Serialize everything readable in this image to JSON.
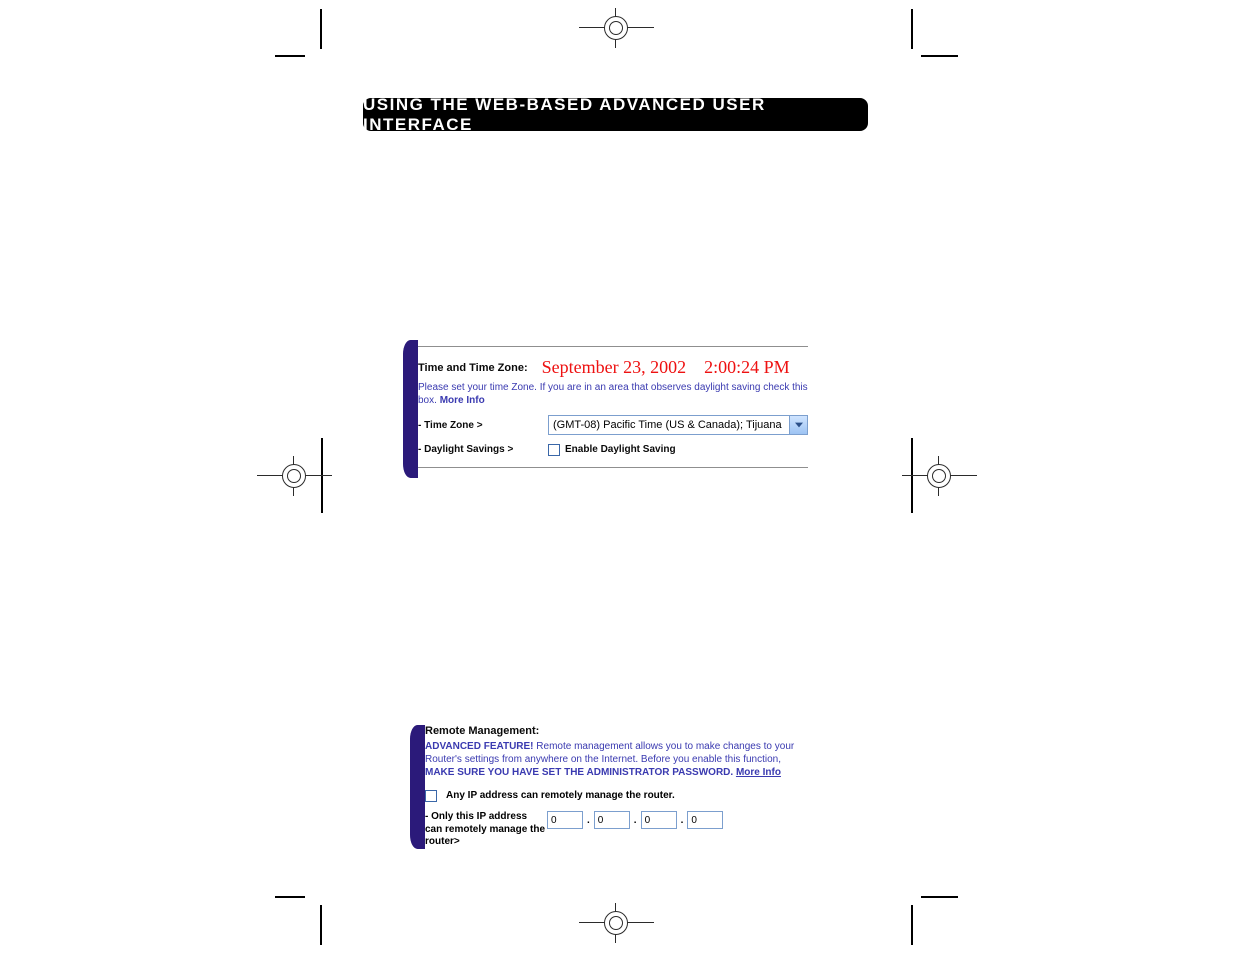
{
  "title": "USING THE WEB-BASED ADVANCED USER INTERFACE",
  "time_panel": {
    "heading": "Time and Time Zone:",
    "date": "September 23, 2002",
    "time": "2:00:24 PM",
    "help": "Please set your time Zone. If you are in an area that observes daylight saving check this box.",
    "more_info": "More Info",
    "tz_label": "- Time Zone >",
    "tz_value": "(GMT-08) Pacific Time (US & Canada); Tijuana",
    "ds_label": "- Daylight Savings >",
    "ds_checkbox_label": "Enable Daylight Saving"
  },
  "remote_panel": {
    "heading": "Remote Management:",
    "adv_label": "ADVANCED FEATURE!",
    "body": "Remote management allows you to make changes to your Router's settings from anywhere on the Internet. Before you enable this function,",
    "warn": "MAKE SURE YOU HAVE SET THE ADMINISTRATOR PASSWORD.",
    "more_info": "More Info",
    "any_ip_label": "Any IP address can remotely manage the router.",
    "only_ip_label": "- Only this IP address can remotely manage the router>",
    "ip": [
      "0",
      "0",
      "0",
      "0"
    ],
    "dot": "."
  }
}
